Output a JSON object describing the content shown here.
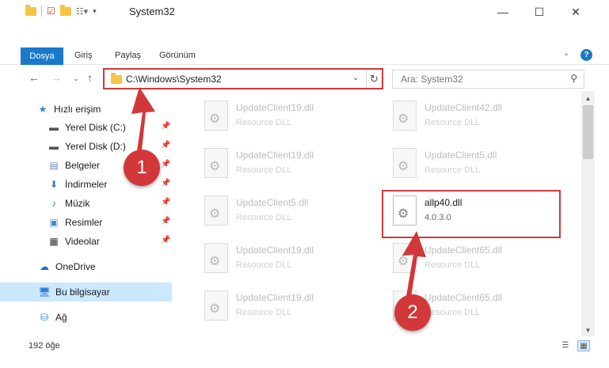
{
  "window": {
    "title": "System32",
    "minimize": "—",
    "maximize": "☐",
    "close": "✕"
  },
  "ribbon": {
    "tabs": [
      "Dosya",
      "Giriş",
      "Paylaş",
      "Görünüm"
    ],
    "help": "?"
  },
  "address": {
    "path": "C:\\Windows\\System32",
    "search_placeholder": "Ara: System32"
  },
  "sidebar": {
    "items": [
      {
        "label": "Hızlı erişim",
        "icon": "star-icon",
        "pinned": false
      },
      {
        "label": "Yerel Disk (C:)",
        "icon": "drive-icon",
        "pinned": true
      },
      {
        "label": "Yerel Disk (D:)",
        "icon": "drive-icon",
        "pinned": true
      },
      {
        "label": "Belgeler",
        "icon": "document-icon",
        "pinned": true
      },
      {
        "label": "İndirmeler",
        "icon": "download-icon",
        "pinned": true
      },
      {
        "label": "Müzik",
        "icon": "music-icon",
        "pinned": true
      },
      {
        "label": "Resimler",
        "icon": "picture-icon",
        "pinned": true
      },
      {
        "label": "Videolar",
        "icon": "video-icon",
        "pinned": true
      },
      {
        "label": "OneDrive",
        "icon": "cloud-icon",
        "pinned": false
      },
      {
        "label": "Bu bilgisayar",
        "icon": "computer-icon",
        "pinned": false,
        "active": true
      },
      {
        "label": "Ağ",
        "icon": "network-icon",
        "pinned": false
      }
    ]
  },
  "files": [
    {
      "name": "UpdateClient19.dll",
      "sub": "Resource DLL"
    },
    {
      "name": "UpdateClient42.dll",
      "sub": "Resource DLL"
    },
    {
      "name": "UpdateClient19.dll",
      "sub": "Resource DLL"
    },
    {
      "name": "UpdateClient5.dll",
      "sub": "Resource DLL"
    },
    {
      "name": "UpdateClient5.dll",
      "sub": "Resource DLL"
    },
    {
      "name": "allp40.dll",
      "sub": "4.0.3.0",
      "selected": true
    },
    {
      "name": "UpdateClient19.dll",
      "sub": "Resource DLL"
    },
    {
      "name": "UpdateClient65.dll",
      "sub": "Resource DLL"
    },
    {
      "name": "UpdateClient19.dll",
      "sub": "Resource DLL"
    },
    {
      "name": "UpdateClient65.dll",
      "sub": "Resource DLL"
    }
  ],
  "status": {
    "count": "192 öğe"
  },
  "annotations": {
    "step1": "1",
    "step2": "2",
    "color": "#d2383a"
  }
}
